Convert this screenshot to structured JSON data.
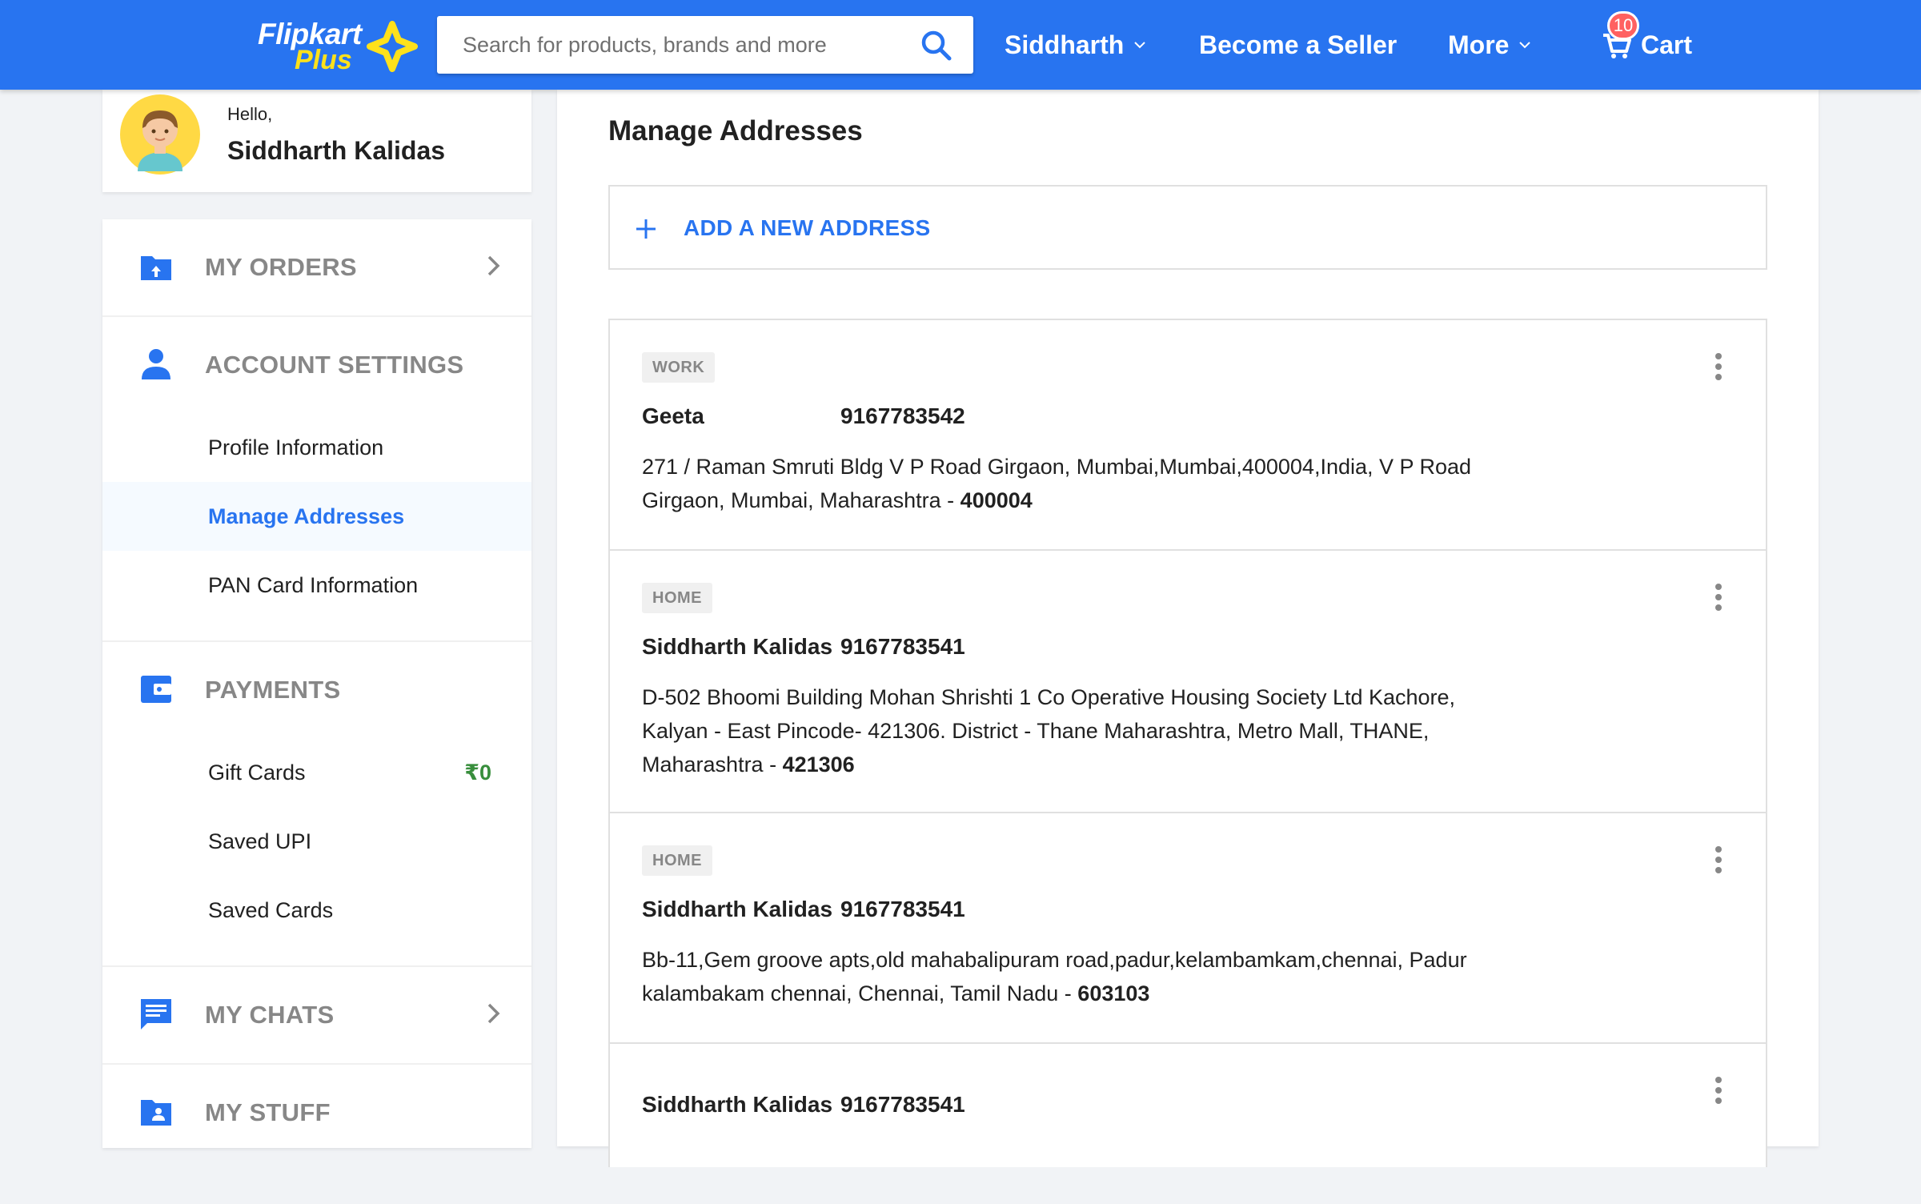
{
  "header": {
    "logo_text": "Flipkart",
    "logo_plus": "Plus",
    "search_placeholder": "Search for products, brands and more",
    "user_menu": "Siddharth",
    "seller_link": "Become a Seller",
    "more_menu": "More",
    "cart_label": "Cart",
    "cart_count": "10"
  },
  "sidebar": {
    "greeting": "Hello,",
    "user_name": "Siddharth Kalidas",
    "sections": {
      "orders": {
        "title": "MY ORDERS",
        "icon": "orders-icon"
      },
      "account": {
        "title": "ACCOUNT SETTINGS",
        "icon": "person-icon",
        "items": [
          "Profile Information",
          "Manage Addresses",
          "PAN Card Information"
        ],
        "active": "Manage Addresses"
      },
      "payments": {
        "title": "PAYMENTS",
        "icon": "wallet-icon",
        "items": [
          "Gift Cards",
          "Saved UPI",
          "Saved Cards"
        ],
        "gift_card_balance": "₹0"
      },
      "chats": {
        "title": "MY CHATS",
        "icon": "chat-icon"
      },
      "stuff": {
        "title": "MY STUFF",
        "icon": "folder-icon"
      }
    }
  },
  "main": {
    "title": "Manage Addresses",
    "add_label": "ADD A NEW ADDRESS",
    "addresses": [
      {
        "tag": "WORK",
        "name": "Geeta",
        "phone": "9167783542",
        "address": "271 / Raman Smruti Bldg V P Road Girgaon, Mumbai,Mumbai,400004,India, V P Road Girgaon, Mumbai, Maharashtra - ",
        "pincode": "400004"
      },
      {
        "tag": "HOME",
        "name": "Siddharth Kalidas",
        "phone": "9167783541",
        "address": "D-502 Bhoomi Building Mohan Shrishti 1 Co Operative Housing Society Ltd Kachore, Kalyan - East Pincode- 421306. District - Thane Maharashtra, Metro Mall, THANE, Maharashtra - ",
        "pincode": "421306"
      },
      {
        "tag": "HOME",
        "name": "Siddharth Kalidas",
        "phone": "9167783541",
        "address": "Bb-11,Gem groove apts,old mahabalipuram road,padur,kelambamkam,chennai, Padur kalambakam chennai, Chennai, Tamil Nadu - ",
        "pincode": "603103"
      },
      {
        "tag": "",
        "name": "Siddharth Kalidas",
        "phone": "9167783541",
        "address": "",
        "pincode": ""
      }
    ]
  },
  "colors": {
    "brand_blue": "#2874f0",
    "logo_yellow": "#ffe11b",
    "price_green": "#388e3c",
    "badge_red": "#ff6161",
    "muted_gray": "#878787"
  }
}
